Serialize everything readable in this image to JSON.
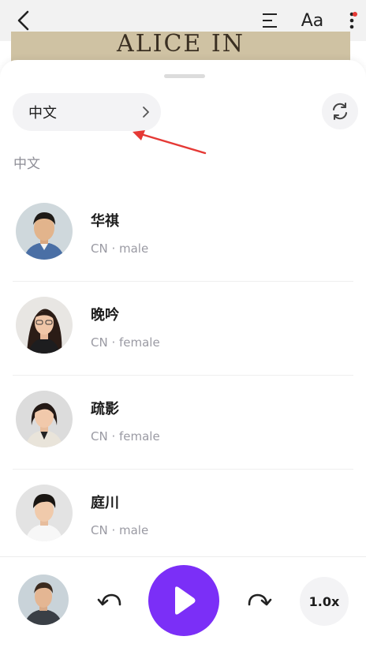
{
  "header": {
    "back_icon": "chevron-left-icon",
    "toc_icon": "table-of-contents-icon",
    "font_settings_label": "Aa",
    "more_icon": "more-vertical-icon",
    "notification_dot_color": "#e53935"
  },
  "book_banner": {
    "title": "ALICE IN WONDERLAND"
  },
  "language_selector": {
    "label": "中文",
    "chevron_icon": "chevron-right-icon",
    "refresh_icon": "refresh-icon"
  },
  "annotation": {
    "arrow_color": "#e53935"
  },
  "section": {
    "label": "中文"
  },
  "voices": [
    {
      "name": "华祺",
      "meta": "CN · male",
      "avatar": "man-suit-avatar"
    },
    {
      "name": "晚吟",
      "meta": "CN · female",
      "avatar": "woman-glasses-avatar"
    },
    {
      "name": "疏影",
      "meta": "CN · female",
      "avatar": "woman-blazer-avatar"
    },
    {
      "name": "庭川",
      "meta": "CN · male",
      "avatar": "young-man-avatar"
    }
  ],
  "player": {
    "current_voice_avatar": "man-portrait-avatar",
    "rewind_icon": "rewind-icon",
    "play_icon": "play-icon",
    "forward_icon": "forward-icon",
    "speed": "1.0x",
    "accent_color": "#7b2ff7"
  }
}
